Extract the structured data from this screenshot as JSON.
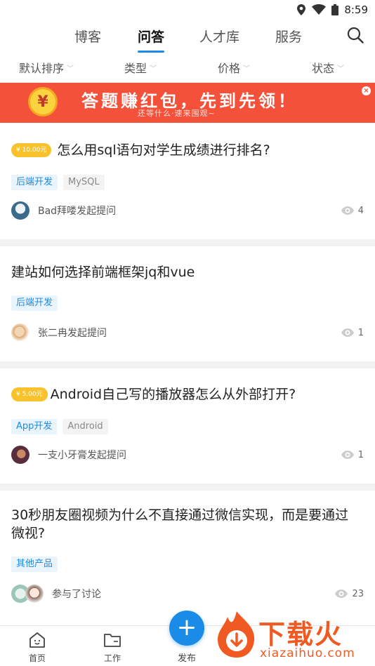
{
  "status_bar": {
    "time": "8:59"
  },
  "top_nav": {
    "tabs": [
      {
        "label": "博客"
      },
      {
        "label": "问答"
      },
      {
        "label": "人才库"
      },
      {
        "label": "服务"
      }
    ],
    "active_tab": "问答"
  },
  "filters": [
    {
      "label": "默认排序"
    },
    {
      "label": "类型"
    },
    {
      "label": "价格"
    },
    {
      "label": "状态"
    }
  ],
  "banner": {
    "title": "答题赚红包，先到先领！",
    "subtitle": "还等什么·速来围观~",
    "coin_symbol": "¥",
    "close_symbol": "×"
  },
  "questions": [
    {
      "reward": "¥ 10.00元",
      "title": "怎么用sql语句对学生成绩进行排名?",
      "tags": [
        "后端开发",
        "MySQL"
      ],
      "meta": "Bad拜喽发起提问",
      "views": "4"
    },
    {
      "reward": "",
      "title": "建站如何选择前端框架jq和vue",
      "tags": [
        "后端开发"
      ],
      "meta": "张二冉发起提问",
      "views": "1"
    },
    {
      "reward": "¥ 5.00元",
      "title": "Android自己写的播放器怎么从外部打开?",
      "tags": [
        "App开发",
        "Android"
      ],
      "meta": "一支小牙膏发起提问",
      "views": "1"
    },
    {
      "reward": "",
      "title": "30秒朋友圈视频为什么不直接通过微信实现，而是要通过微视?",
      "tags": [
        "其他产品"
      ],
      "meta": "参与了讨论",
      "views": "23"
    }
  ],
  "bottom_nav": {
    "home": "首页",
    "work": "工作",
    "publish": "发布",
    "publish_symbol": "+"
  },
  "watermark": {
    "text": "下载火",
    "sub": "xiazaihuo.com"
  },
  "colors": {
    "accent": "#1a8ce8",
    "banner": "#f4513b",
    "reward": "#f7c22b"
  }
}
